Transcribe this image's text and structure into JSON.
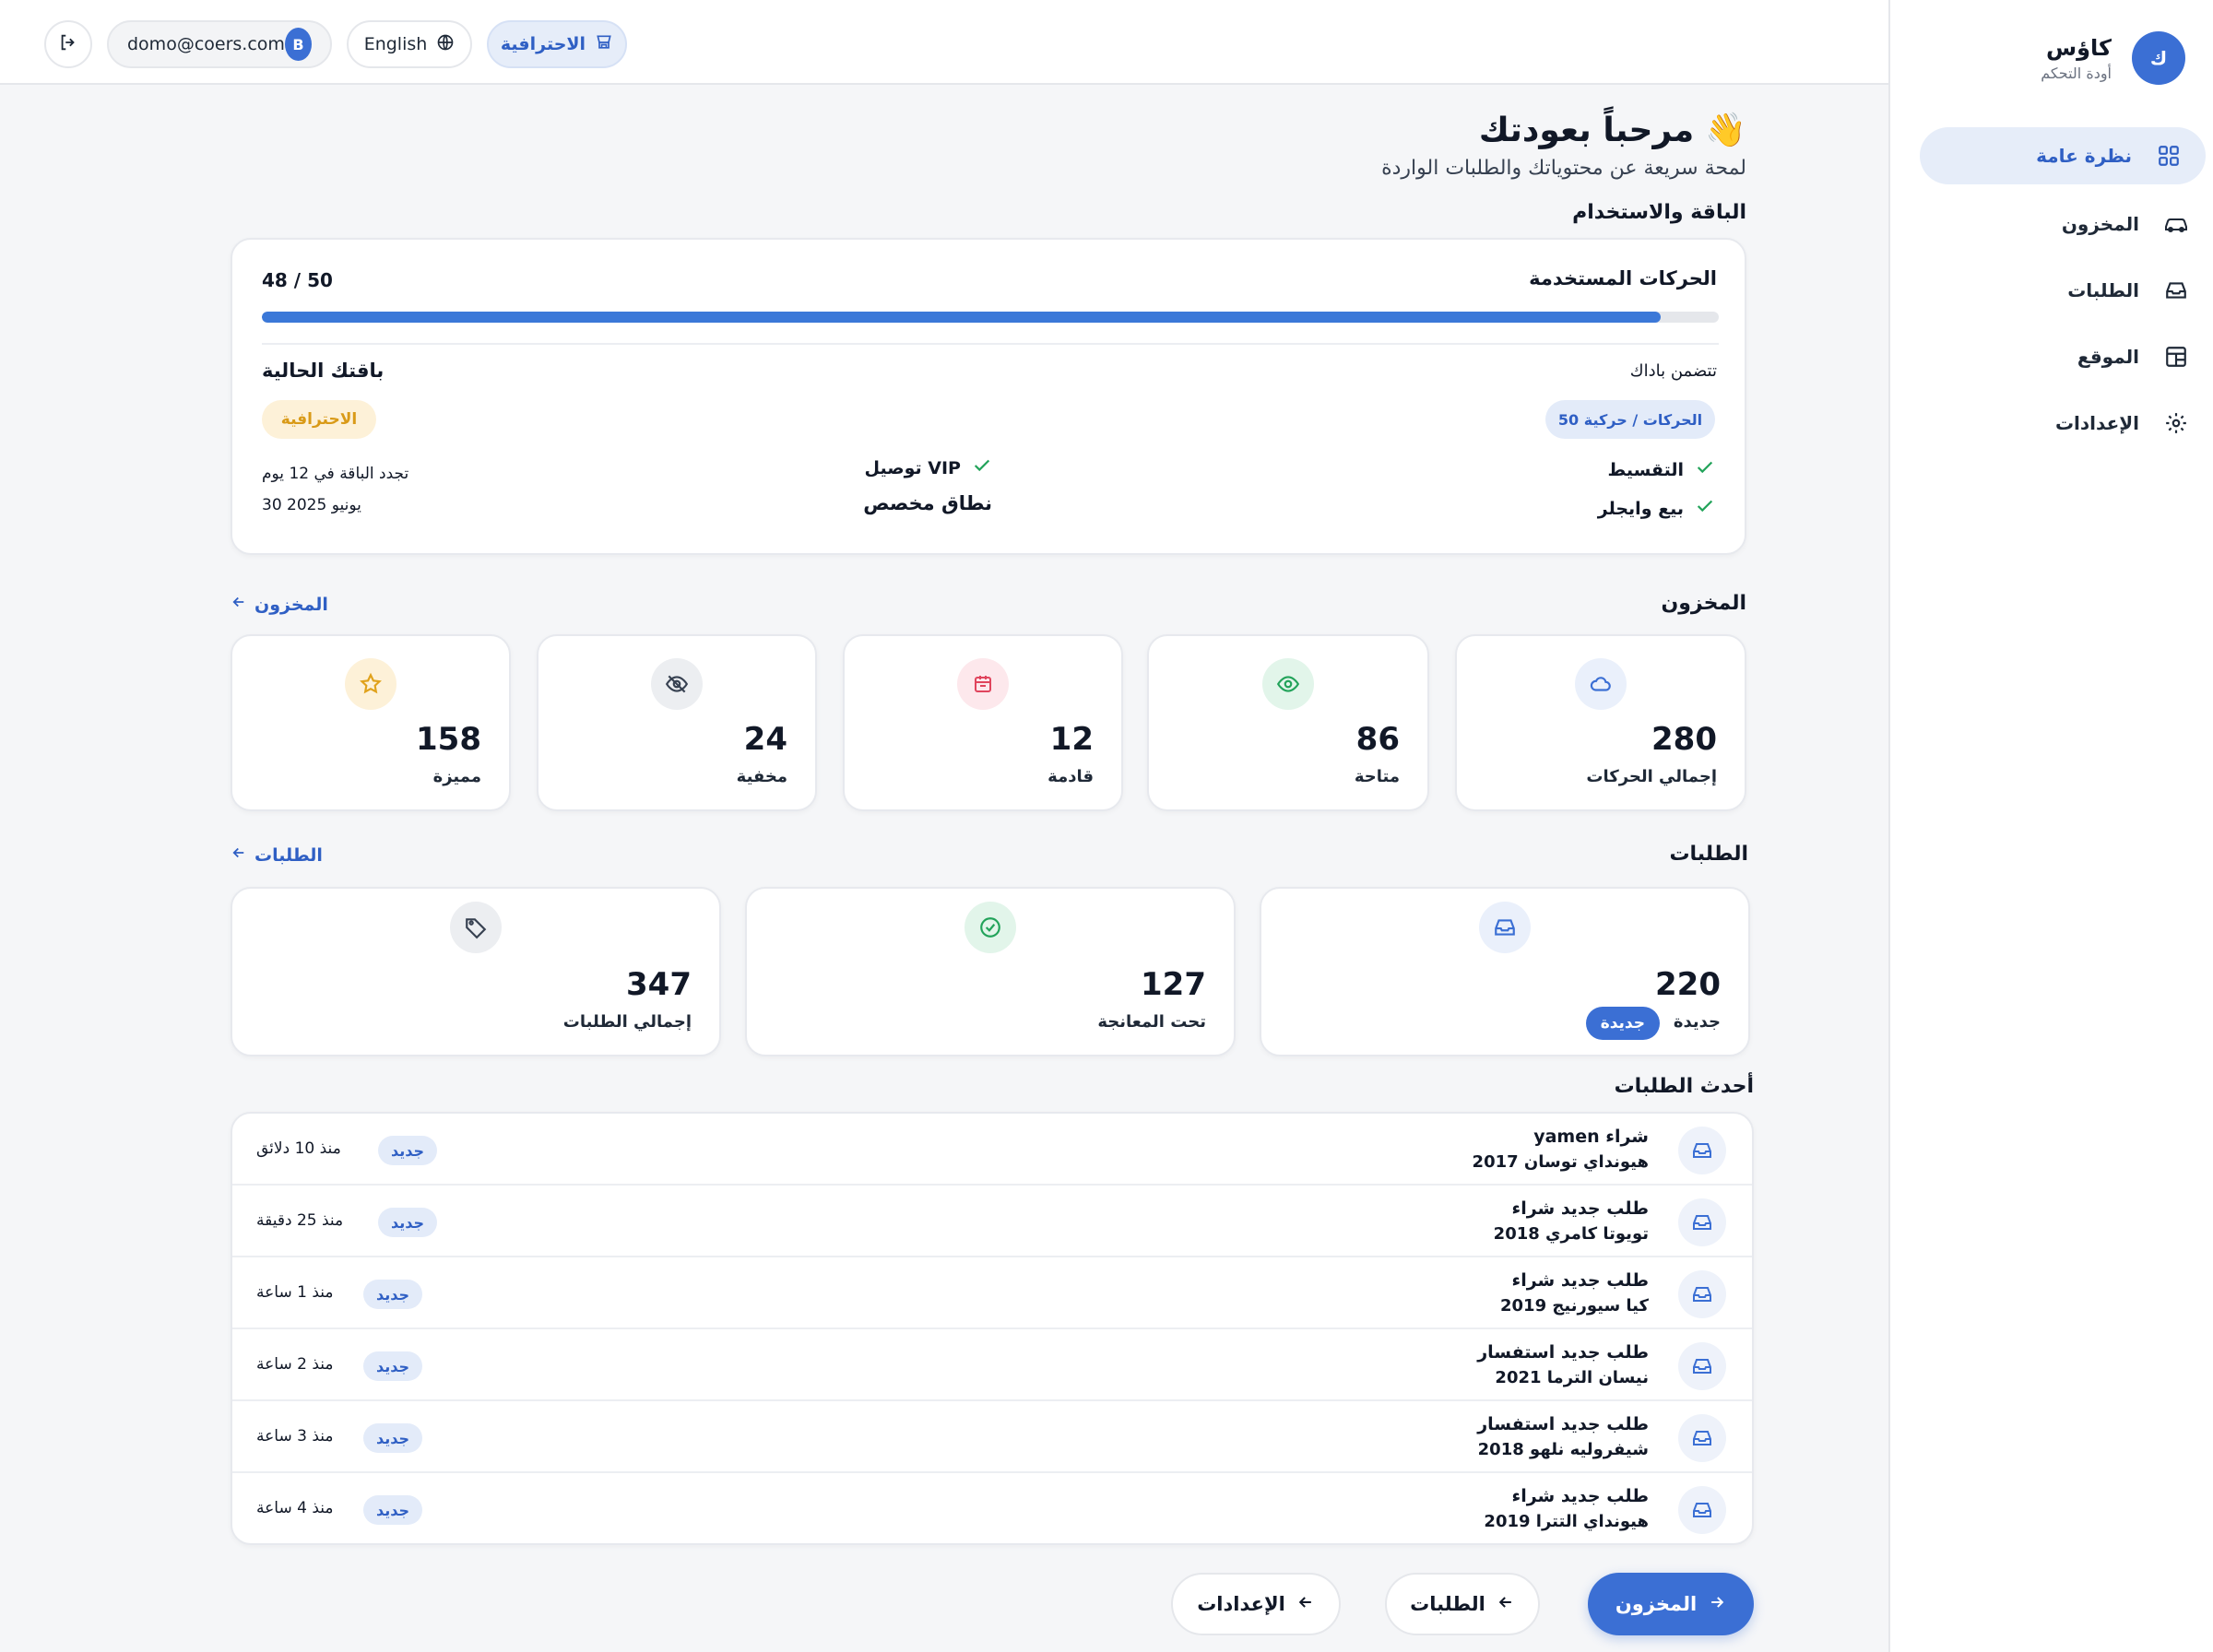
{
  "sidebar": {
    "brand_name": "كاؤس",
    "brand_sub": "أودة التحكم",
    "brand_avatar": "ك",
    "items": [
      {
        "label": "نظرة عامة",
        "icon": "grid-icon",
        "active": true
      },
      {
        "label": "المخزون",
        "icon": "car-icon",
        "active": false
      },
      {
        "label": "الطلبات",
        "icon": "inbox-icon",
        "active": false
      },
      {
        "label": "الموقع",
        "icon": "layout-icon",
        "active": false
      },
      {
        "label": "الإعدادات",
        "icon": "gear-icon",
        "active": false
      }
    ]
  },
  "topbar": {
    "email": "domo@coers.com",
    "user_initial": "B",
    "language": "English",
    "plan": "الاحترافية"
  },
  "welcome": {
    "title": "مرحباً بعودتك",
    "emoji": "👋",
    "subtitle": "لمحة سريعة عن محتوياتك والطلبات الواردة"
  },
  "plan_section": {
    "title": "الباقة والاستخدام",
    "moves_label": "الحركات المستخدمة",
    "moves_count": "48 / 50",
    "progress_fraction": 0.96,
    "includes_label": "تتضمن باداك",
    "includes_badge": "50 الحركات / حركية",
    "current_plan_label": "باقتك الحالية",
    "current_plan_badge": "الاحترافية",
    "features": [
      "التقسيط",
      "بيع وايجلر",
      "توصيل VIP",
      "نطاق مخصص"
    ],
    "renew_text": "تجدد الباقة في 12 يوم",
    "renew_date": "30 يونيو 2025"
  },
  "inventory": {
    "title": "المخزون",
    "link": "المخزون",
    "stats": [
      {
        "value": "280",
        "label": "إجمالي الحركات",
        "icon": "cloud-icon",
        "bg": "#eaf0fb",
        "fg": "#3b6fd4"
      },
      {
        "value": "86",
        "label": "متاحة",
        "icon": "eye-icon",
        "bg": "#e2f5ea",
        "fg": "#22a35a"
      },
      {
        "value": "12",
        "label": "قادمة",
        "icon": "calendar-icon",
        "bg": "#fde8ec",
        "fg": "#e0455d"
      },
      {
        "value": "24",
        "label": "مخفية",
        "icon": "eye-off-icon",
        "bg": "#eceef1",
        "fg": "#374151"
      },
      {
        "value": "158",
        "label": "مميزة",
        "icon": "star-icon",
        "bg": "#fdf1d8",
        "fg": "#e0a21b"
      }
    ]
  },
  "requests": {
    "title": "الطلبات",
    "link": "الطلبات",
    "stats": [
      {
        "value": "220",
        "label": "جديدة",
        "chip": "جديدة",
        "icon": "inbox-icon",
        "bg": "#eaf0fb",
        "fg": "#3b6fd4"
      },
      {
        "value": "127",
        "label": "تحت المعانجة",
        "icon": "check-circle-icon",
        "bg": "#e2f5ea",
        "fg": "#22a35a"
      },
      {
        "value": "347",
        "label": "إجمالي الطلبات",
        "icon": "tag-icon",
        "bg": "#eceef1",
        "fg": "#374151"
      }
    ]
  },
  "latest": {
    "title": "أحدث الطلبات",
    "rows": [
      {
        "title": "yamen  شراء",
        "sub": "هيونداي توسان 2017",
        "badge": "جديد",
        "time": "منذ 10 دلائق"
      },
      {
        "title": "طلب جديد  شراء",
        "sub": "تويوتا كامري 2018",
        "badge": "جديد",
        "time": "منذ 25 دقيقة"
      },
      {
        "title": "طلب جديد  شراء",
        "sub": "كيا سيورنيج 2019",
        "badge": "جديد",
        "time": "منذ 1 ساعة"
      },
      {
        "title": "طلب جديد   استفسار",
        "sub": "نيسان الترما 2021",
        "badge": "جديد",
        "time": "منذ 2 ساعة"
      },
      {
        "title": "طلب جديد   استفسار",
        "sub": "شيفروليه نلهو 2018",
        "badge": "جديد",
        "time": "منذ 3 ساعة"
      },
      {
        "title": "طلب جديد شراء",
        "sub": "هيونداي التترا 2019",
        "badge": "جديد",
        "time": "منذ 4 ساعة"
      }
    ]
  },
  "actions": {
    "inventory": "المخزون",
    "requests": "الطلبات",
    "settings": "الإعدادات"
  },
  "colors": {
    "accent": "#3b6fd4",
    "progress": "#3b78d8",
    "gold": "#d99a17"
  }
}
